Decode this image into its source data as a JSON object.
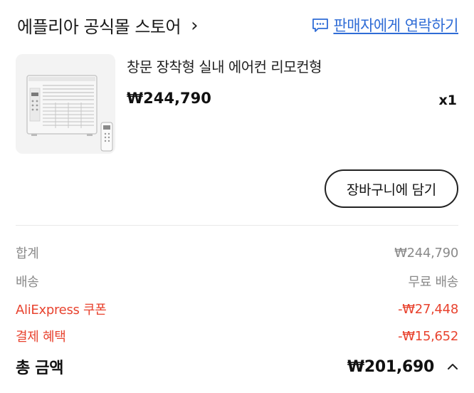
{
  "header": {
    "store_name": "에플리아 공식몰 스토어",
    "chevron": "›",
    "contact_label": "판매자에게 연락하기",
    "contact_icon": "chat-bubble-icon",
    "accent": "#2f6cd6"
  },
  "product": {
    "name": "창문 장착형 실내 에어컨 리모컨형",
    "price": "₩244,790",
    "quantity": "x1",
    "image_icon": "air-conditioner-image"
  },
  "actions": {
    "add_to_cart": "장바구니에 담기"
  },
  "summary": {
    "subtotal_label": "합계",
    "subtotal_value": "₩244,790",
    "shipping_label": "배송",
    "shipping_value": "무료 배송",
    "coupon_label": "AliExpress 쿠폰",
    "coupon_value": "-₩27,448",
    "payment_label": "결제 혜택",
    "payment_value": "-₩15,652",
    "total_label": "총 금액",
    "total_value": "₩201,690",
    "discount_color": "#e8432f"
  }
}
